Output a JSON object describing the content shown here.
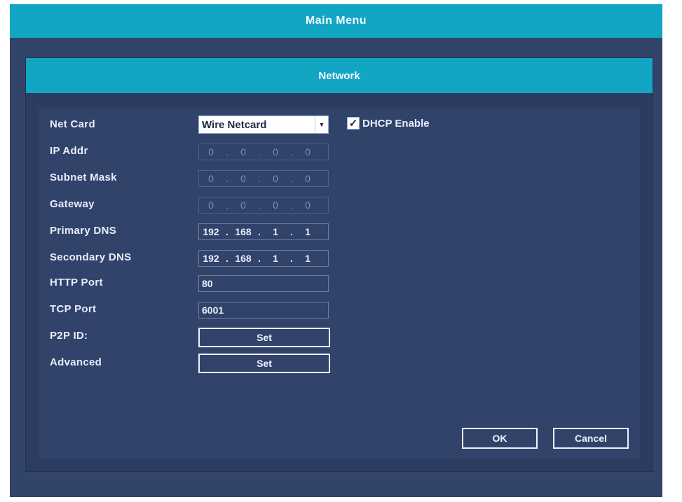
{
  "window": {
    "title": "Main Menu"
  },
  "dialog": {
    "title": "Network"
  },
  "labels": {
    "net_card": "Net Card",
    "ip_addr": "IP Addr",
    "subnet_mask": "Subnet Mask",
    "gateway": "Gateway",
    "primary_dns": "Primary DNS",
    "secondary_dns": "Secondary DNS",
    "http_port": "HTTP Port",
    "tcp_port": "TCP Port",
    "p2p_id": "P2P ID:",
    "advanced": "Advanced"
  },
  "net_card": {
    "selected": "Wire Netcard"
  },
  "dhcp": {
    "label": "DHCP Enable",
    "checked": true
  },
  "ip_addr": [
    "0",
    "0",
    "0",
    "0"
  ],
  "subnet_mask": [
    "0",
    "0",
    "0",
    "0"
  ],
  "gateway": [
    "0",
    "0",
    "0",
    "0"
  ],
  "primary_dns": [
    "192",
    "168",
    "1",
    "1"
  ],
  "secondary_dns": [
    "192",
    "168",
    "1",
    "1"
  ],
  "http_port": "80",
  "tcp_port": "6001",
  "buttons": {
    "p2p_set": "Set",
    "advanced_set": "Set",
    "ok": "OK",
    "cancel": "Cancel"
  },
  "icons": {
    "dropdown": "chevron-down-icon",
    "checkbox": "checkmark-icon"
  },
  "colors": {
    "header": "#13a5c4",
    "panel": "#31426b",
    "frame": "#33446a"
  }
}
